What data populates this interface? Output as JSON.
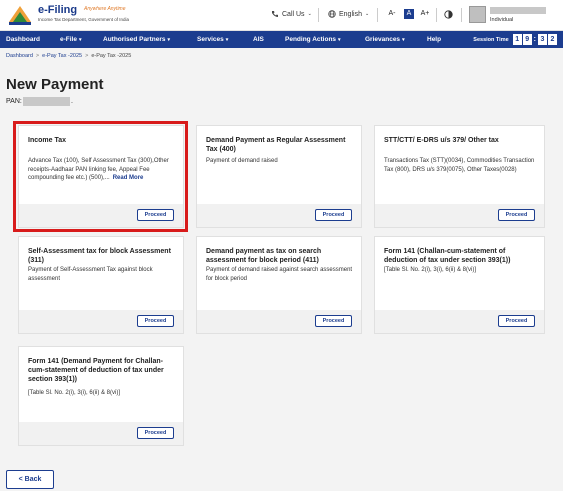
{
  "header": {
    "logo_title": "e-Filing",
    "logo_tagline": "Anywhere Anytime",
    "logo_subtitle": "Income Tax Department, Government of India",
    "call_us": "Call Us",
    "language": "English",
    "font_small": "A-",
    "font_normal": "A",
    "font_large": "A+",
    "user_role": "Individual"
  },
  "nav": {
    "items": [
      "Dashboard",
      "e-File",
      "Authorised Partners",
      "Services",
      "AIS",
      "Pending Actions",
      "Grievances",
      "Help"
    ],
    "session_label": "Session Time",
    "session_digits": [
      "1",
      "9",
      "3",
      "2"
    ]
  },
  "breadcrumb": {
    "items": [
      "Dashboard",
      "e-Pay Tax -2025",
      "e-Pay Tax -2025"
    ]
  },
  "page": {
    "title": "New Payment",
    "pan_label": "PAN:",
    "pan_suffix": "."
  },
  "cards": [
    {
      "title": "Income Tax",
      "desc": "Advance Tax (100), Self Assessment Tax (300),Other receipts-Aadhaar PAN linking fee, Appeal Fee compounding fee etc.) (500),...",
      "read_more": "Read More",
      "proceed": "Proceed"
    },
    {
      "title": "Demand Payment as Regular Assessment Tax (400)",
      "desc": "Payment of demand raised",
      "proceed": "Proceed"
    },
    {
      "title": "STT/CTT/ E-DRS u/s 379/ Other tax",
      "desc": "Transactions Tax (STT)(0034), Commodities Transaction Tax (800), DRS u/s 379(0075), Other Taxes(0028)",
      "proceed": "Proceed"
    },
    {
      "title": "Self-Assessment tax for block Assessment (311)",
      "desc": "Payment of Self-Assessment Tax against block assessment",
      "proceed": "Proceed"
    },
    {
      "title": "Demand payment as tax on search assessment for block period (411)",
      "desc": "Payment of demand raised against search assessment for block period",
      "proceed": "Proceed"
    },
    {
      "title": "Form 141 (Challan-cum-statement of deduction of tax under section 393(1))",
      "desc": "[Table Sl. No. 2(i), 3(i), 6(ii) & 8(vi)]",
      "proceed": "Proceed"
    },
    {
      "title": "Form 141 (Demand Payment for Challan-cum-statement of deduction of tax under section 393(1))",
      "desc": "[Table Sl. No. 2(i), 3(i), 6(ii) & 8(vi)]",
      "proceed": "Proceed"
    }
  ],
  "back_label": "< Back",
  "colors": {
    "primary": "#1c3d8f",
    "highlight": "#d81b1b"
  }
}
